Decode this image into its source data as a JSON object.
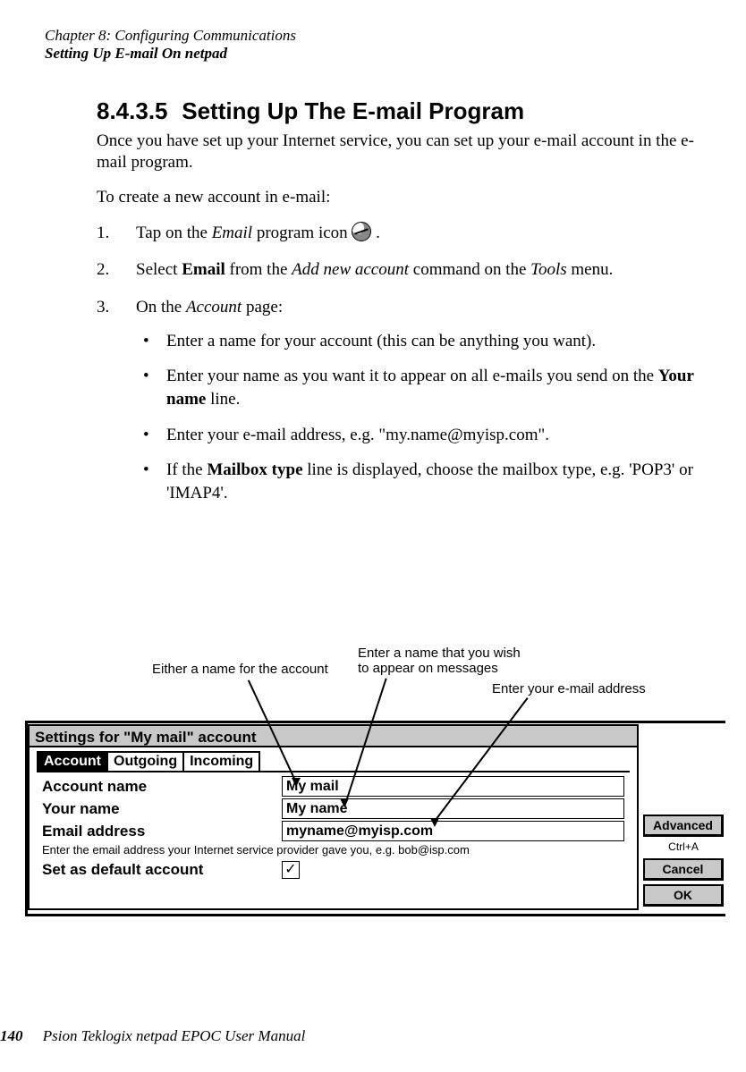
{
  "header": {
    "chapter": "Chapter 8:  Configuring Communications",
    "section": "Setting Up E-mail On netpad"
  },
  "heading": {
    "number": "8.4.3.5",
    "title": "Setting Up The E-mail Program"
  },
  "intro1": "Once you have set up your Internet service, you can set up your e-mail account in the e-mail program.",
  "intro2": "To create a new account in e-mail:",
  "step1_pre": "Tap on the ",
  "step1_em": "Email",
  "step1_post": " program icon ",
  "step1_tail": " .",
  "step2_pre": "Select ",
  "step2_b": "Email",
  "step2_mid1": " from the ",
  "step2_em1": "Add new account",
  "step2_mid2": " command on the ",
  "step2_em2": "Tools",
  "step2_tail": " menu.",
  "step3_pre": "On the ",
  "step3_em": "Account",
  "step3_tail": " page:",
  "b1": "Enter a name for your account (this can be anything you want).",
  "b2_pre": "Enter your name as you want it to appear on all e-mails you send on the ",
  "b2_b": "Your name",
  "b2_tail": " line.",
  "b3": "Enter your e-mail address, e.g. \"my.name@myisp.com\".",
  "b4_pre": "If the ",
  "b4_b": "Mailbox type",
  "b4_mid": " line is displayed, choose the mailbox type, e.g. 'POP3' or 'IMAP4'.",
  "anno": {
    "left": "Either a name for the account",
    "mid": "Enter a name that you wish\nto appear on messages",
    "right": "Enter your e-mail address"
  },
  "dialog": {
    "title": "Settings for \"My mail\" account",
    "tabs": {
      "account": "Account",
      "outgoing": "Outgoing",
      "incoming": "Incoming"
    },
    "labels": {
      "account_name": "Account name",
      "your_name": "Your name",
      "email": "Email address",
      "default": "Set as default account"
    },
    "values": {
      "account_name": "My mail",
      "your_name": "My name",
      "email": "myname@myisp.com",
      "default_checked": "✓"
    },
    "hint": "Enter the email address your Internet service provider gave you, e.g. bob@isp.com",
    "buttons": {
      "advanced": "Advanced",
      "advanced_sc": "Ctrl+A",
      "cancel": "Cancel",
      "ok": "OK"
    }
  },
  "footer": {
    "page": "140",
    "title": "Psion Teklogix netpad EPOC User Manual"
  }
}
